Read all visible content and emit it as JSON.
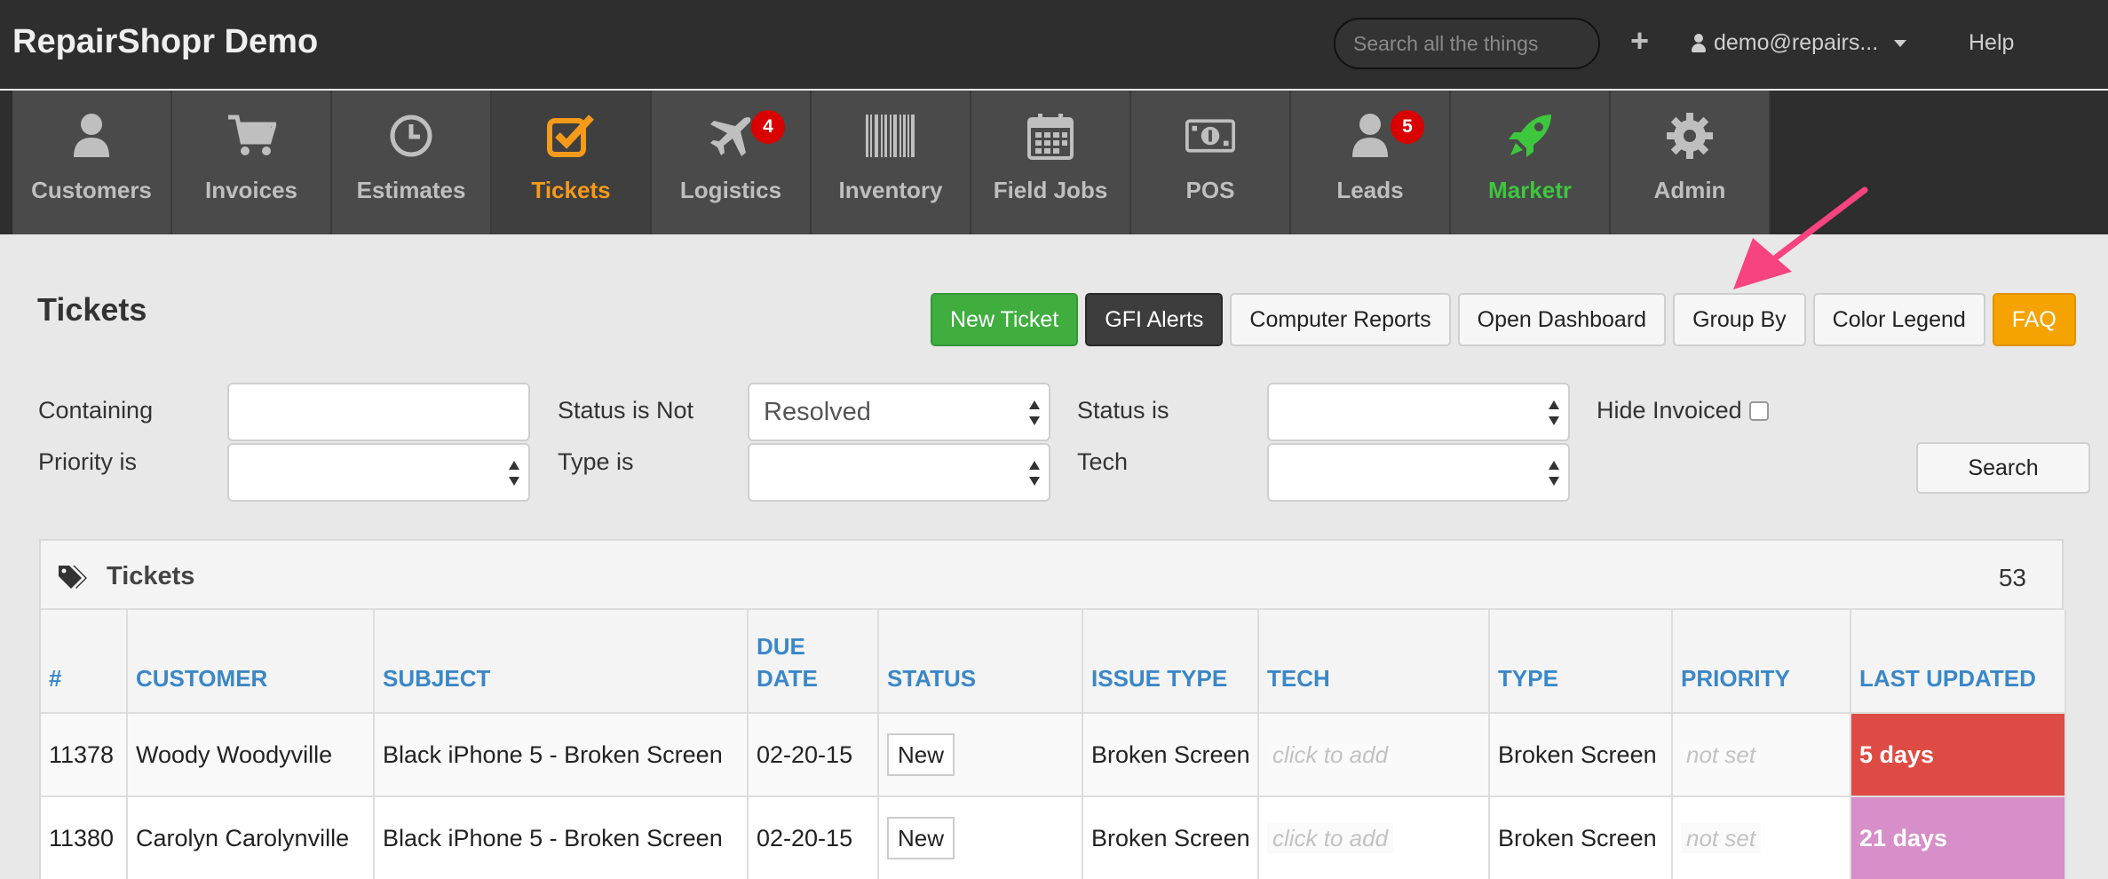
{
  "app": {
    "title": "RepairShopr Demo"
  },
  "header": {
    "search_placeholder": "Search all the things",
    "plus": "+",
    "user": "demo@repairs...",
    "help": "Help"
  },
  "nav": {
    "items": [
      {
        "label": "Customers",
        "icon": "user-icon"
      },
      {
        "label": "Invoices",
        "icon": "cart-icon"
      },
      {
        "label": "Estimates",
        "icon": "clock-icon"
      },
      {
        "label": "Tickets",
        "icon": "check-square-icon",
        "active": true
      },
      {
        "label": "Logistics",
        "icon": "plane-icon",
        "badge": "4"
      },
      {
        "label": "Inventory",
        "icon": "barcode-icon"
      },
      {
        "label": "Field Jobs",
        "icon": "calendar-icon"
      },
      {
        "label": "POS",
        "icon": "money-icon"
      },
      {
        "label": "Leads",
        "icon": "user-icon",
        "badge": "5"
      },
      {
        "label": "Marketr",
        "icon": "rocket-icon"
      },
      {
        "label": "Admin",
        "icon": "gear-icon"
      }
    ]
  },
  "page": {
    "title": "Tickets"
  },
  "toolbar": {
    "new_ticket": "New Ticket",
    "gfi_alerts": "GFI Alerts",
    "computer_reports": "Computer Reports",
    "open_dashboard": "Open Dashboard",
    "group_by": "Group By",
    "color_legend": "Color Legend",
    "faq": "FAQ"
  },
  "filters": {
    "containing_label": "Containing",
    "containing_value": "",
    "status_not_label": "Status is Not",
    "status_not_value": "Resolved",
    "status_is_label": "Status is",
    "status_is_value": "",
    "hide_invoiced_label": "Hide Invoiced",
    "priority_label": "Priority is",
    "priority_value": "",
    "type_label": "Type is",
    "type_value": "",
    "tech_label": "Tech",
    "tech_value": "",
    "search_button": "Search"
  },
  "panel": {
    "title": "Tickets",
    "count": "53"
  },
  "table": {
    "headers": [
      "#",
      "CUSTOMER",
      "SUBJECT",
      "DUE DATE",
      "STATUS",
      "ISSUE TYPE",
      "TECH",
      "TYPE",
      "PRIORITY",
      "LAST UPDATED"
    ],
    "rows": [
      {
        "number": "11378",
        "customer": "Woody Woodyville",
        "subject": "Black iPhone 5 - Broken Screen",
        "due": "02-20-15",
        "status": "New",
        "issue": "Broken Screen",
        "tech": "click to add",
        "type": "Broken Screen",
        "priority": "not set",
        "updated": "5 days"
      },
      {
        "number": "11380",
        "customer": "Carolyn Carolynville",
        "subject": "Black iPhone 5 - Broken Screen",
        "due": "02-20-15",
        "status": "New",
        "issue": "Broken Screen",
        "tech": "click to add",
        "type": "Broken Screen",
        "priority": "not set",
        "updated": "21 days"
      }
    ]
  },
  "colors": {
    "accent_orange": "#f59a1a",
    "marketr_green": "#3dc73d",
    "header_blue": "#3a87c8",
    "stale_red": "#dd4b44",
    "stale_pink": "#d68fc8",
    "annotation_arrow": "#f7437f"
  }
}
